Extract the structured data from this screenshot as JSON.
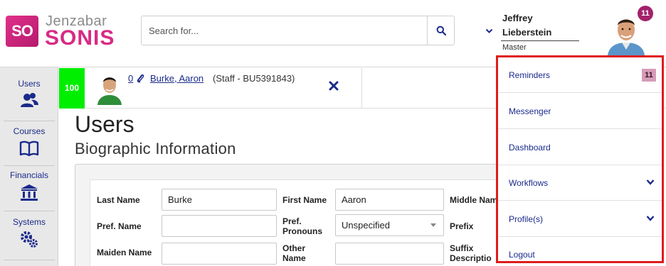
{
  "brand": {
    "logo_text": "SO",
    "name_top": "Jenzabar",
    "name_bottom": "SONIS"
  },
  "search": {
    "placeholder": "Search for...",
    "value": "",
    "button_icon": "search-icon"
  },
  "user": {
    "first_name": "Jeffrey",
    "last_name": "Lieberstein",
    "role": "Master",
    "notification_count": "11"
  },
  "nav": {
    "items": [
      {
        "label": "Users",
        "icon": "users-icon"
      },
      {
        "label": "Courses",
        "icon": "book-icon"
      },
      {
        "label": "Financials",
        "icon": "bank-icon"
      },
      {
        "label": "Systems",
        "icon": "gears-icon"
      }
    ]
  },
  "record": {
    "score": "100",
    "attachment_count": "0",
    "name": "Burke, Aaron",
    "detail": "(Staff - BU5391843)"
  },
  "main": {
    "page_title": "Users",
    "section_title": "Biographic Information"
  },
  "form": {
    "last_name_label": "Last Name",
    "last_name_value": "Burke",
    "first_name_label": "First Name",
    "first_name_value": "Aaron",
    "middle_name_label": "Middle Nam",
    "pref_name_label": "Pref. Name",
    "pref_name_value": "",
    "pref_pronouns_label_1": "Pref.",
    "pref_pronouns_label_2": "Pronouns",
    "pref_pronouns_value": "Unspecified",
    "prefix_label": "Prefix",
    "maiden_name_label": "Maiden Name",
    "maiden_name_value": "",
    "other_name_label_1": "Other",
    "other_name_label_2": "Name",
    "other_name_value": "",
    "suffix_label_1": "Suffix",
    "suffix_label_2": "Descriptio"
  },
  "menu": {
    "items": [
      {
        "label": "Reminders",
        "badge": "11"
      },
      {
        "label": "Messenger"
      },
      {
        "label": "Dashboard"
      },
      {
        "label": "Workflows",
        "expandable": true
      },
      {
        "label": "Profile(s)",
        "expandable": true
      },
      {
        "label": "Logout"
      }
    ]
  },
  "colors": {
    "brand_pink": "#d82a84",
    "link_blue": "#1a2a8c",
    "score_green": "#00ee00",
    "menu_border": "#e01b1b",
    "badge_purple": "#a3226b"
  }
}
